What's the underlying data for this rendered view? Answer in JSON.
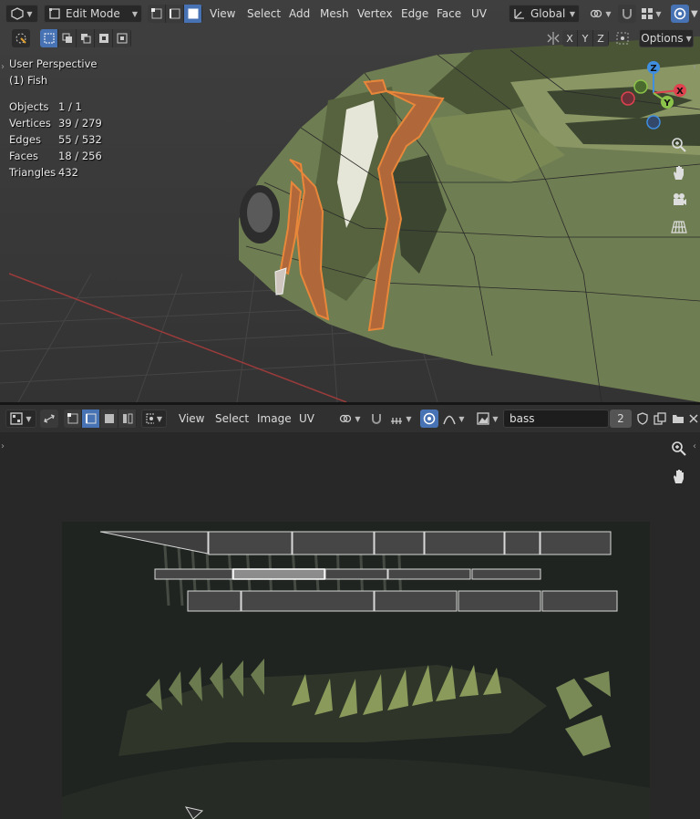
{
  "viewport": {
    "mode_label": "Edit Mode",
    "menus": [
      "View",
      "Select",
      "Add",
      "Mesh",
      "Vertex",
      "Edge",
      "Face",
      "UV"
    ],
    "orientation_label": "Global",
    "options_label": "Options",
    "axis_toggles": [
      "X",
      "Y",
      "Z"
    ],
    "perspective_label": "User Perspective",
    "object_label": "(1) Fish",
    "stats": [
      {
        "label": "Objects",
        "value": "1 / 1"
      },
      {
        "label": "Vertices",
        "value": "39 / 279"
      },
      {
        "label": "Edges",
        "value": "55 / 532"
      },
      {
        "label": "Faces",
        "value": "18 / 256"
      },
      {
        "label": "Triangles",
        "value": "432"
      }
    ],
    "gizmo": {
      "x": "X",
      "y": "Y",
      "z": "Z"
    },
    "colors": {
      "x_axis": "#e0414f",
      "y_axis": "#8bc24a",
      "z_axis": "#3f8ee0",
      "selection": "#e07a2a",
      "active_button": "#4772b3"
    }
  },
  "uv_editor": {
    "menus": [
      "View",
      "Select",
      "Image",
      "UV"
    ],
    "image_name": "bass",
    "users_count": "2"
  }
}
